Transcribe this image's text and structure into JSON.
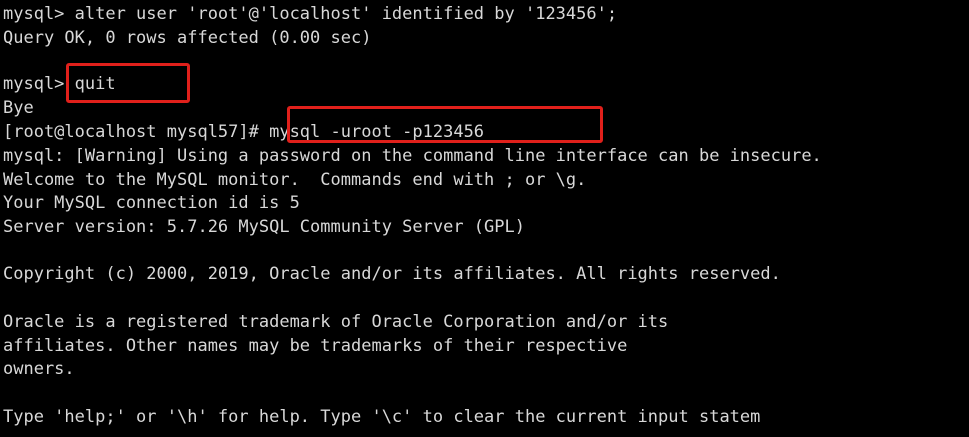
{
  "terminal": {
    "lines": [
      "mysql> alter user 'root'@'localhost' identified by '123456';",
      "Query OK, 0 rows affected (0.00 sec)",
      "",
      "mysql> quit",
      "Bye",
      "[root@localhost mysql57]# mysql -uroot -p123456",
      "mysql: [Warning] Using a password on the command line interface can be insecure.",
      "Welcome to the MySQL monitor.  Commands end with ; or \\g.",
      "Your MySQL connection id is 5",
      "Server version: 5.7.26 MySQL Community Server (GPL)",
      "",
      "Copyright (c) 2000, 2019, Oracle and/or its affiliates. All rights reserved.",
      "",
      "Oracle is a registered trademark of Oracle Corporation and/or its",
      "affiliates. Other names may be trademarks of their respective",
      "owners.",
      "",
      "Type 'help;' or '\\h' for help. Type '\\c' to clear the current input statem"
    ],
    "text_color": "#d8d8d8",
    "background_color": "#000000",
    "highlight_color": "#e0201b"
  }
}
